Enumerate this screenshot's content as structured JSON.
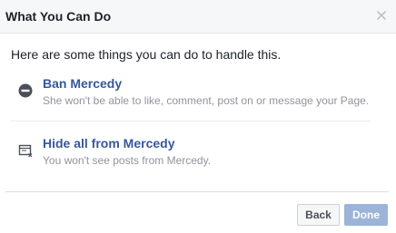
{
  "dialog": {
    "title": "What You Can Do",
    "intro": "Here are some things you can do to handle this."
  },
  "options": [
    {
      "icon": "ban-icon",
      "title": "Ban Mercedy",
      "description": "She won't be able to like, comment, post on or message your Page."
    },
    {
      "icon": "hide-posts-icon",
      "title": "Hide all from Mercedy",
      "description": "You won't see posts from Mercedy."
    }
  ],
  "footer": {
    "back_label": "Back",
    "done_label": "Done"
  },
  "colors": {
    "link": "#365899",
    "done_disabled": "#9cb4d8"
  }
}
